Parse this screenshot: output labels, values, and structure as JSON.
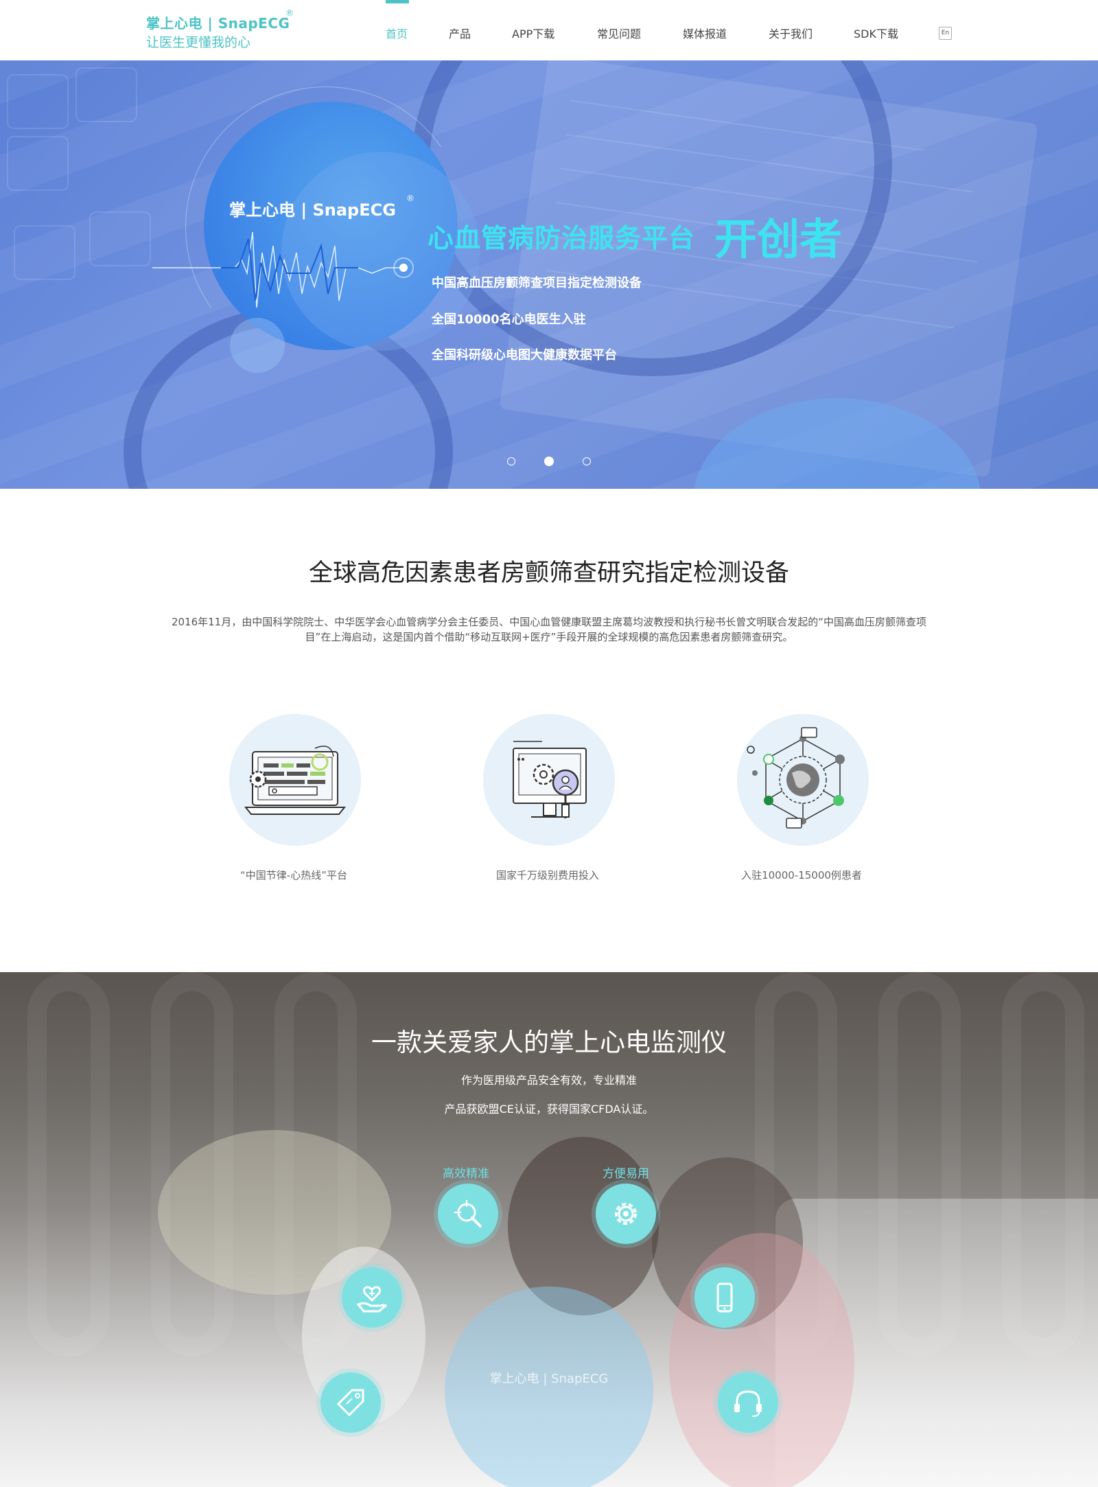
{
  "header": {
    "logo_line1": "掌上心电 | SnapECG",
    "logo_reg": "®",
    "logo_line2": "让医生更懂我的心",
    "nav": [
      "首页",
      "产品",
      "APP下载",
      "常见问题",
      "媒体报道",
      "关于我们",
      "SDK下载"
    ],
    "active_nav": "首页",
    "lang": "En"
  },
  "hero": {
    "brand": "掌上心电 | SnapECG",
    "brand_reg": "®",
    "title_a": "心血管病防治服务平台",
    "title_b": "开创者",
    "lines": [
      "中国高血压房颤筛查项目指定检测设备",
      "全国10000名心电医生入驻",
      "全国科研级心电图大健康数据平台"
    ],
    "slides": 3,
    "active_slide": 2
  },
  "section2": {
    "title": "全球高危因素患者房颤筛查研究指定检测设备",
    "desc": "2016年11月，由中国科学院院士、中华医学会心血管病学分会主任委员、中国心血管健康联盟主席葛均波教授和执行秘书长曾文明联合发起的“中国高血压房颤筛查项目”在上海启动，这是国内首个借助“移动互联网+医疗”手段开展的全球规模的高危因素患者房颤筛查研究。",
    "features": [
      {
        "label": "“中国节律-心热线”平台",
        "icon": "laptop-settings-icon"
      },
      {
        "label": "国家千万级别费用投入",
        "icon": "monitor-search-icon"
      },
      {
        "label": "入驻10000-15000例患者",
        "icon": "globe-network-icon"
      }
    ]
  },
  "section3": {
    "title": "一款关爱家人的掌上心电监测仪",
    "sub1": "作为医用级产品安全有效，专业精准",
    "sub2": "产品获欧盟CE认证，获得国家CFDA认证。",
    "features": [
      {
        "label": "高效精准",
        "icon": "search-crosshair-icon"
      },
      {
        "label": "方便易用",
        "icon": "gear-icon"
      },
      {
        "label": "",
        "icon": "heart-hand-icon"
      },
      {
        "label": "",
        "icon": "smartphone-icon"
      },
      {
        "label": "",
        "icon": "price-tag-icon"
      },
      {
        "label": "",
        "icon": "headset-icon"
      }
    ],
    "center_brand": "掌上心电 | SnapECG"
  },
  "colors": {
    "accent": "#4cc3c7",
    "hero_highlight": "#3ee3f0",
    "hero_bg": "#6f8fdc",
    "feature_circle": "#e6f1f9",
    "feature_icon_bg": "#7fe0e2"
  }
}
